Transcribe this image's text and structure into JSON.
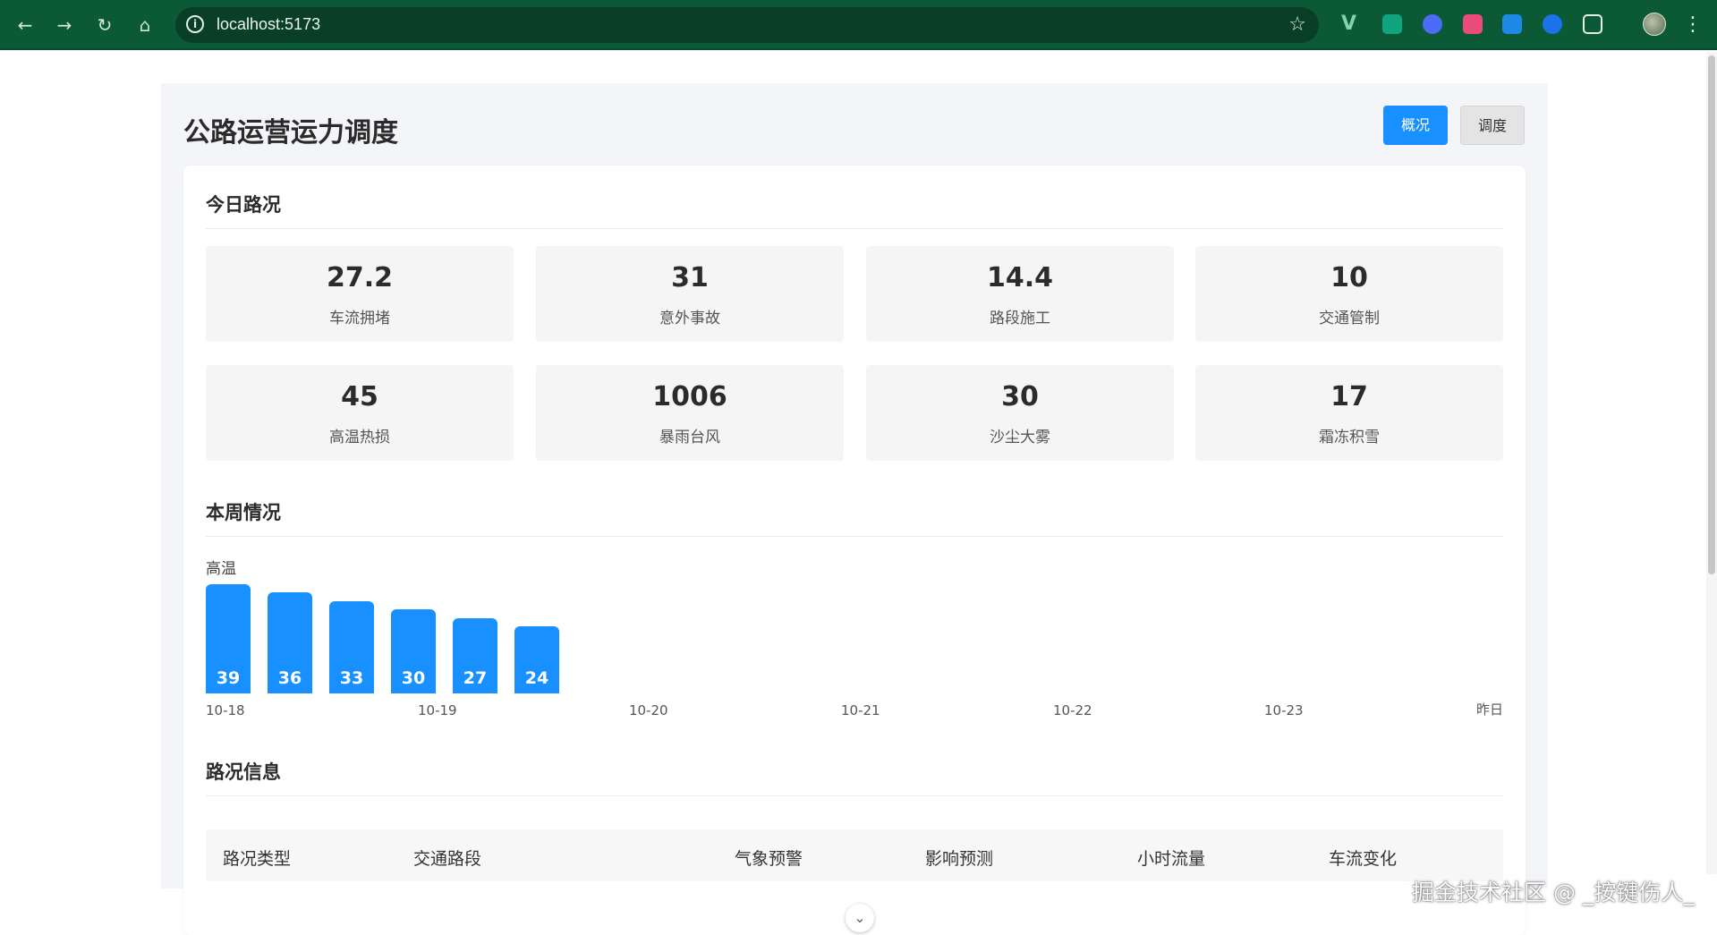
{
  "browser": {
    "url": "localhost:5173",
    "back_icon": "arrow-left-icon",
    "forward_icon": "arrow-right-icon",
    "reload_icon": "reload-icon",
    "home_icon": "home-icon",
    "site_info_icon": "info-icon",
    "bookmark_icon": "star-icon",
    "menu_icon": "more-vert-icon"
  },
  "header": {
    "title": "公路运营运力调度",
    "buttons": [
      {
        "label": "概况",
        "active": true
      },
      {
        "label": "调度",
        "active": false
      }
    ]
  },
  "today": {
    "title": "今日路况",
    "stats": [
      {
        "value": "27.2",
        "label": "车流拥堵"
      },
      {
        "value": "31",
        "label": "意外事故"
      },
      {
        "value": "14.4",
        "label": "路段施工"
      },
      {
        "value": "10",
        "label": "交通管制"
      },
      {
        "value": "45",
        "label": "高温热损"
      },
      {
        "value": "1006",
        "label": "暴雨台风"
      },
      {
        "value": "30",
        "label": "沙尘大雾"
      },
      {
        "value": "17",
        "label": "霜冻积雪"
      }
    ]
  },
  "week": {
    "title": "本周情况",
    "metric_label": "高温"
  },
  "chart_data": {
    "type": "bar",
    "title": "",
    "series": [
      {
        "name": "高温",
        "values": [
          39,
          36,
          33,
          30,
          27,
          24
        ]
      }
    ],
    "values": [
      39,
      36,
      33,
      30,
      27,
      24
    ],
    "xticks": [
      "10-18",
      "10-19",
      "10-20",
      "10-21",
      "10-22",
      "10-23",
      "昨日"
    ],
    "bar_color": "#1890ff",
    "ylim": [
      0,
      39
    ],
    "grid": false
  },
  "road_info": {
    "title": "路况信息",
    "columns": [
      "路况类型",
      "交通路段",
      "气象预警",
      "影响预测",
      "小时流量",
      "车流变化"
    ]
  },
  "watermark": "掘金技术社区 @ _按键伤人_",
  "colors": {
    "primary": "#1890ff",
    "browser_bar": "#0b5a35"
  }
}
